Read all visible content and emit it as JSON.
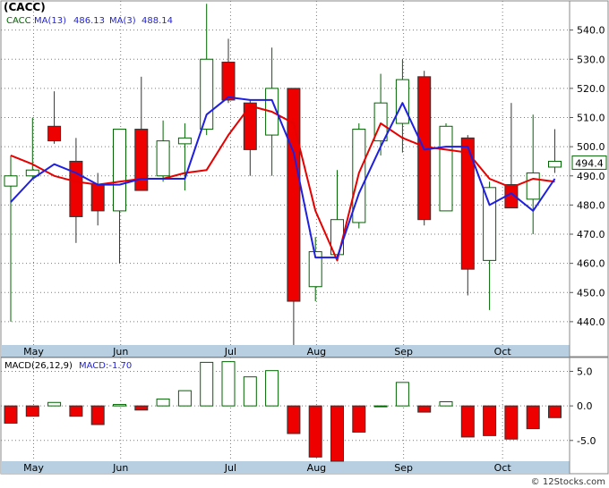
{
  "colors": {
    "up_body": "#ffffff",
    "up_stroke": "#006400",
    "down_fill": "#ee0000",
    "down_stroke": "#333333",
    "ma13": "#e60000",
    "ma3": "#1f1fe0",
    "grid": "#7a7a7a",
    "axis_band": "#b7cfe0",
    "macd_pos_stroke": "#006400",
    "macd_neg_fill": "#ee0000",
    "price_tag_bg": "#ffffff",
    "price_tag_border": "#006400"
  },
  "header": {
    "ticker": "(CACC)",
    "legend_ticker": "CACC",
    "legend_ma13": "MA(13)",
    "legend_ma13_value": "486.13",
    "legend_ma3": "MA(3)",
    "legend_ma3_value": "488.14",
    "macd_label": "MACD(26,12,9)",
    "macd_value_label": "MACD:-1.70"
  },
  "footer": {
    "credit": "© 12Stocks.com"
  },
  "chart_data": [
    {
      "type": "candlestick",
      "title": "(CACC)",
      "x_months": [
        "May",
        "Jun",
        "Jul",
        "Aug",
        "Sep",
        "Oct"
      ],
      "ylim": [
        432,
        550
      ],
      "y_ticks": [
        "440.0",
        "450.0",
        "460.0",
        "470.0",
        "480.0",
        "490.0",
        "500.0",
        "510.0",
        "520.0",
        "530.0",
        "540.0"
      ],
      "last_price_label": "494.4",
      "last_price": 494.4,
      "candles": [
        {
          "o": 486.5,
          "h": 497,
          "l": 440,
          "c": 490
        },
        {
          "o": 490,
          "h": 510,
          "l": 489,
          "c": 492
        },
        {
          "o": 507,
          "h": 519,
          "l": 501,
          "c": 502
        },
        {
          "o": 495,
          "h": 503,
          "l": 467,
          "c": 476
        },
        {
          "o": 487,
          "h": 491,
          "l": 473,
          "c": 478
        },
        {
          "o": 478,
          "h": 506,
          "l": 460,
          "c": 506
        },
        {
          "o": 506,
          "h": 524,
          "l": 485,
          "c": 485
        },
        {
          "o": 490,
          "h": 509,
          "l": 488,
          "c": 502
        },
        {
          "o": 501,
          "h": 508,
          "l": 485,
          "c": 503
        },
        {
          "o": 506,
          "h": 549,
          "l": 504,
          "c": 530
        },
        {
          "o": 529,
          "h": 537,
          "l": 515,
          "c": 516
        },
        {
          "o": 515,
          "h": 516,
          "l": 490,
          "c": 499
        },
        {
          "o": 504,
          "h": 534,
          "l": 490,
          "c": 520
        },
        {
          "o": 520,
          "h": 520,
          "l": 432,
          "c": 447
        },
        {
          "o": 452,
          "h": 469,
          "l": 447,
          "c": 464
        },
        {
          "o": 463,
          "h": 492,
          "l": 461,
          "c": 475
        },
        {
          "o": 474,
          "h": 508,
          "l": 472,
          "c": 506
        },
        {
          "o": 502,
          "h": 525,
          "l": 497,
          "c": 515
        },
        {
          "o": 508,
          "h": 530,
          "l": 498,
          "c": 523
        },
        {
          "o": 524,
          "h": 526,
          "l": 473,
          "c": 475
        },
        {
          "o": 478,
          "h": 508,
          "l": 478,
          "c": 507
        },
        {
          "o": 503,
          "h": 504,
          "l": 449,
          "c": 458
        },
        {
          "o": 461,
          "h": 488,
          "l": 444,
          "c": 486
        },
        {
          "o": 487,
          "h": 515,
          "l": 480,
          "c": 479
        },
        {
          "o": 482,
          "h": 511,
          "l": 470,
          "c": 491
        },
        {
          "o": 493,
          "h": 506,
          "l": 491,
          "c": 495
        }
      ],
      "series": [
        {
          "name": "MA(13)",
          "start_index": 0,
          "values": [
            497,
            494,
            490,
            488,
            487,
            488,
            489,
            489,
            491,
            492,
            504,
            514,
            512,
            508,
            478,
            461,
            491,
            508,
            503,
            500,
            499,
            498,
            489,
            486,
            489,
            488
          ]
        },
        {
          "name": "MA(3)",
          "start_index": 0,
          "values": [
            481,
            489,
            494,
            491,
            487,
            487,
            489,
            489,
            489,
            511,
            517,
            516,
            516,
            498,
            462,
            462,
            484,
            500,
            515,
            499,
            500,
            500,
            480,
            484,
            478,
            489
          ]
        }
      ]
    },
    {
      "type": "bar",
      "title": "MACD(26,12,9)",
      "ylim": [
        -8,
        7
      ],
      "y_ticks": [
        "5.0",
        "0.0",
        "-5.0"
      ],
      "values": [
        -2.5,
        -1.5,
        0.5,
        -1.5,
        -2.7,
        0.2,
        -0.6,
        1.0,
        2.2,
        6.3,
        6.4,
        4.2,
        5.1,
        -4.0,
        -7.4,
        -8.0,
        -3.8,
        0.0,
        3.4,
        -0.9,
        0.6,
        -4.5,
        -4.3,
        -4.8,
        -3.3,
        -1.7
      ]
    }
  ]
}
